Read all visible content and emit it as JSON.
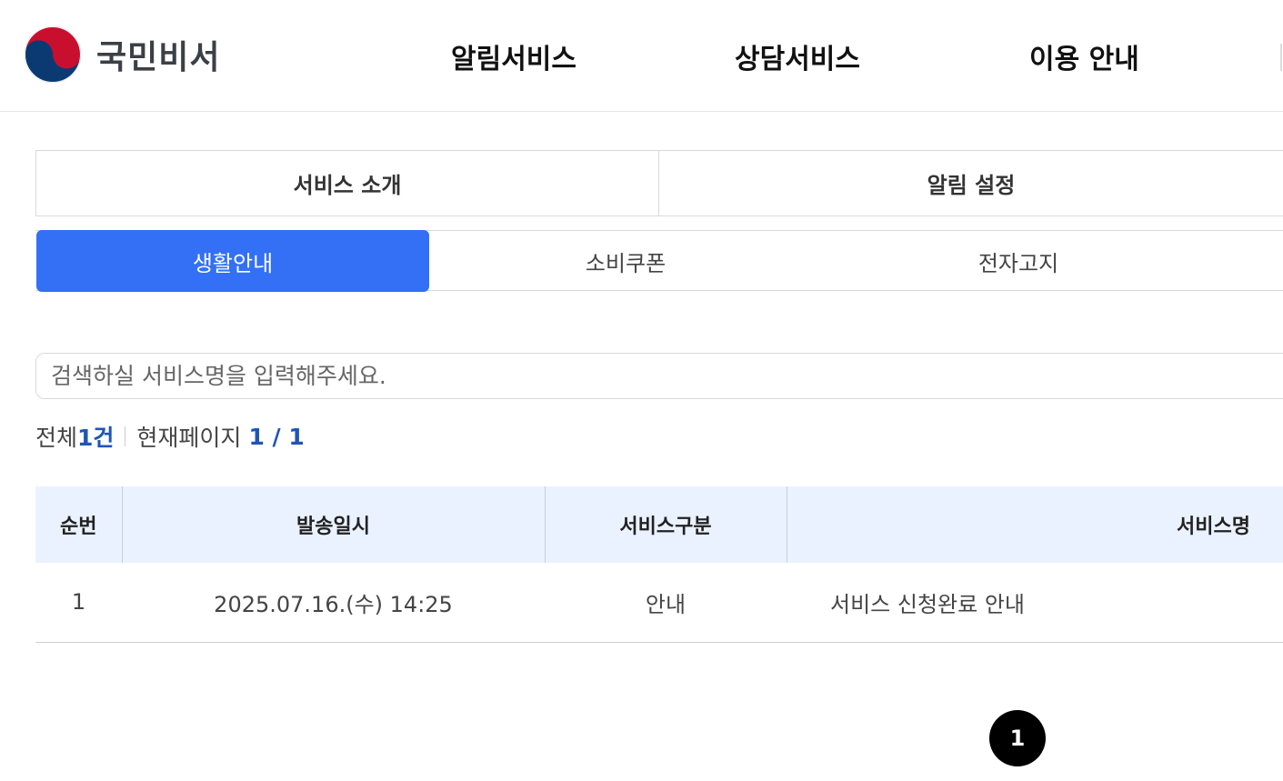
{
  "header": {
    "logo_text": "국민비서",
    "nav": [
      "알림서비스",
      "상담서비스",
      "이용 안내"
    ]
  },
  "main_tabs": [
    "서비스 소개",
    "알림 설정"
  ],
  "sub_tabs": {
    "items": [
      "생활안내",
      "소비쿠폰",
      "전자고지"
    ],
    "active": "생활안내"
  },
  "search": {
    "placeholder": "검색하실 서비스명을 입력해주세요."
  },
  "summary": {
    "total_label": "전체",
    "total_count": "1건",
    "page_label": "현재페이지",
    "page_value": "1 / 1"
  },
  "table": {
    "headers": [
      "순번",
      "발송일시",
      "서비스구분",
      "서비스명"
    ],
    "rows": [
      [
        "1",
        "2025.07.16.(수) 14:25",
        "안내",
        "서비스 신청완료 안내"
      ]
    ]
  },
  "pagination": {
    "current": "1"
  },
  "colors": {
    "accent": "#3370f5",
    "header_bg": "#ebf2ff",
    "count_highlight": "#1f55b5"
  }
}
